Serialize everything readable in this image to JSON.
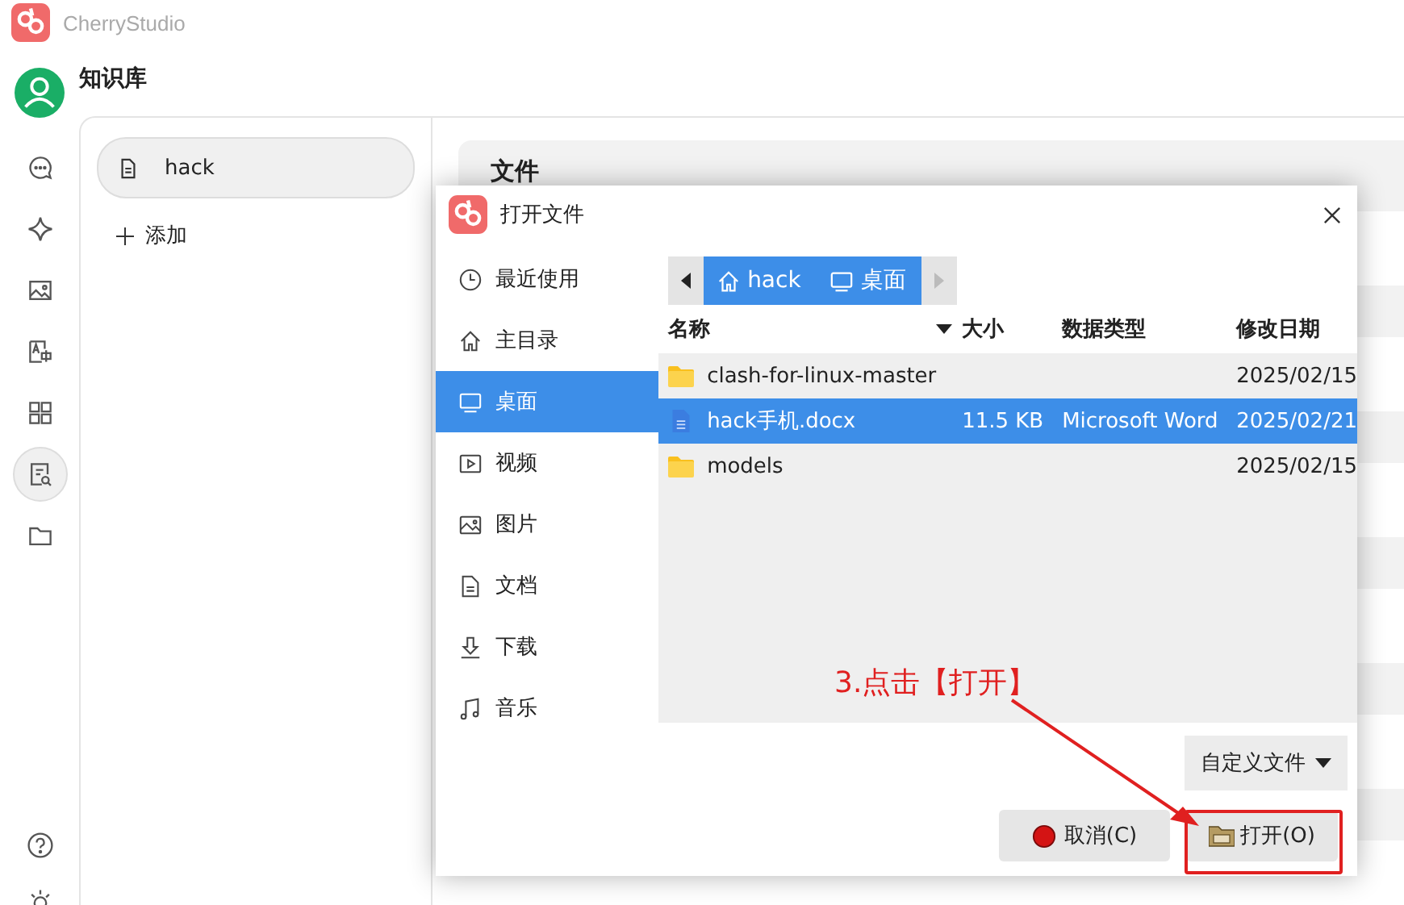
{
  "app": {
    "title": "CherryStudio"
  },
  "header": {
    "title": "知识库"
  },
  "rail": [
    {
      "kind": "chat",
      "selected": false
    },
    {
      "kind": "sparkle",
      "selected": false
    },
    {
      "kind": "image",
      "selected": false
    },
    {
      "kind": "translate",
      "selected": false
    },
    {
      "kind": "apps",
      "selected": false
    },
    {
      "kind": "knowledge",
      "selected": true
    },
    {
      "kind": "folder",
      "selected": false
    }
  ],
  "rail_bottom": [
    {
      "kind": "help"
    },
    {
      "kind": "sun"
    }
  ],
  "knowledge_list": {
    "items": [
      {
        "label": "hack",
        "selected": true
      }
    ],
    "add_label": "添加"
  },
  "content": {
    "section_title": "文件"
  },
  "dialog": {
    "title": "打开文件",
    "places": [
      {
        "label": "最近使用",
        "kind": "recent",
        "selected": false
      },
      {
        "label": "主目录",
        "kind": "home",
        "selected": false
      },
      {
        "label": "桌面",
        "kind": "desktop",
        "selected": true
      },
      {
        "label": "视频",
        "kind": "video",
        "selected": false
      },
      {
        "label": "图片",
        "kind": "image",
        "selected": false
      },
      {
        "label": "文档",
        "kind": "document",
        "selected": false
      },
      {
        "label": "下载",
        "kind": "download",
        "selected": false
      },
      {
        "label": "音乐",
        "kind": "music",
        "selected": false
      }
    ],
    "breadcrumb": [
      {
        "label": "hack",
        "kind": "home"
      },
      {
        "label": "桌面",
        "kind": "desktop"
      }
    ],
    "columns": [
      {
        "label": "名称",
        "sorted": true
      },
      {
        "label": "大小",
        "sorted": false
      },
      {
        "label": "数据类型",
        "sorted": false
      },
      {
        "label": "修改日期",
        "sorted": false
      }
    ],
    "rows": [
      {
        "kind": "folder",
        "name": "clash-for-linux-master",
        "size": "",
        "type": "",
        "modified": "2025/02/15",
        "selected": false
      },
      {
        "kind": "document",
        "name": "hack手机.docx",
        "size": "11.5 KB",
        "type": "Microsoft Word",
        "modified": "2025/02/21",
        "selected": true
      },
      {
        "kind": "folder",
        "name": "models",
        "size": "",
        "type": "",
        "modified": "2025/02/15",
        "selected": false
      }
    ],
    "filter": "自定义文件",
    "buttons": [
      {
        "kind": "cancel",
        "label": "取消(C)"
      },
      {
        "kind": "open",
        "label": "打开(O)"
      }
    ]
  },
  "annotation": {
    "text": "3.点击【打开】"
  }
}
